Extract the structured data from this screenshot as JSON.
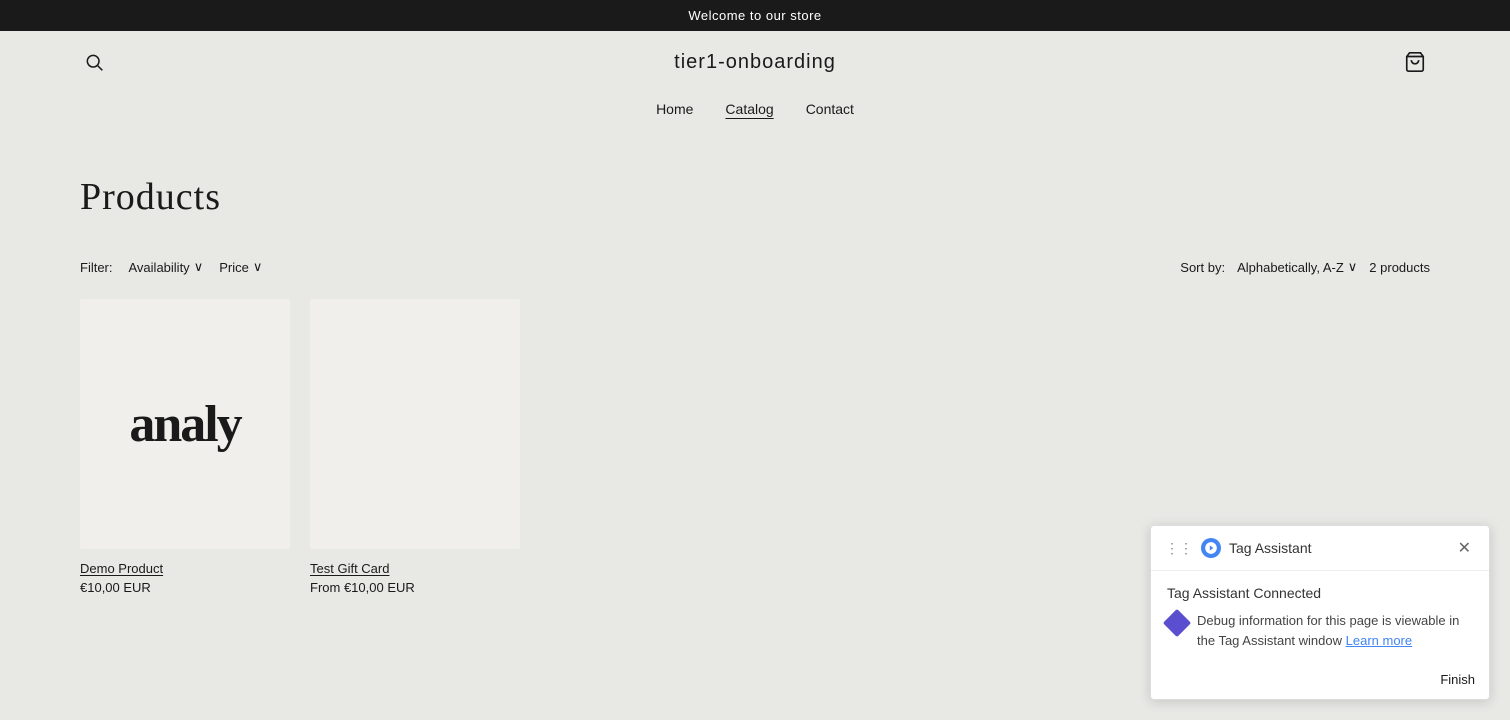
{
  "announcement": {
    "text": "Welcome to our store"
  },
  "header": {
    "store_name": "tier1-onboarding",
    "search_aria": "Search",
    "cart_aria": "Cart"
  },
  "nav": {
    "items": [
      {
        "label": "Home",
        "active": false
      },
      {
        "label": "Catalog",
        "active": true
      },
      {
        "label": "Contact",
        "active": false
      }
    ]
  },
  "page": {
    "title": "Products"
  },
  "filter": {
    "label": "Filter:",
    "availability_label": "Availability",
    "price_label": "Price",
    "sort_label": "Sort by:",
    "sort_value": "Alphabetically, A-Z",
    "products_count": "2 products"
  },
  "products": [
    {
      "name": "Demo Product",
      "price": "€10,00 EUR",
      "image_text": "analy",
      "has_image": true
    },
    {
      "name": "Test Gift Card",
      "price": "From €10,00 EUR",
      "image_text": "",
      "has_image": false
    }
  ],
  "tag_assistant": {
    "title": "Tag Assistant",
    "connected_label": "Tag Assistant Connected",
    "info_text": "Debug information for this page is viewable in the Tag Assistant window",
    "learn_more_label": "Learn more",
    "finish_label": "Finish"
  },
  "icons": {
    "search": "🔍",
    "cart": "🛒",
    "close": "✕",
    "chevron_down": "∨",
    "drag": "⋮⋮"
  }
}
